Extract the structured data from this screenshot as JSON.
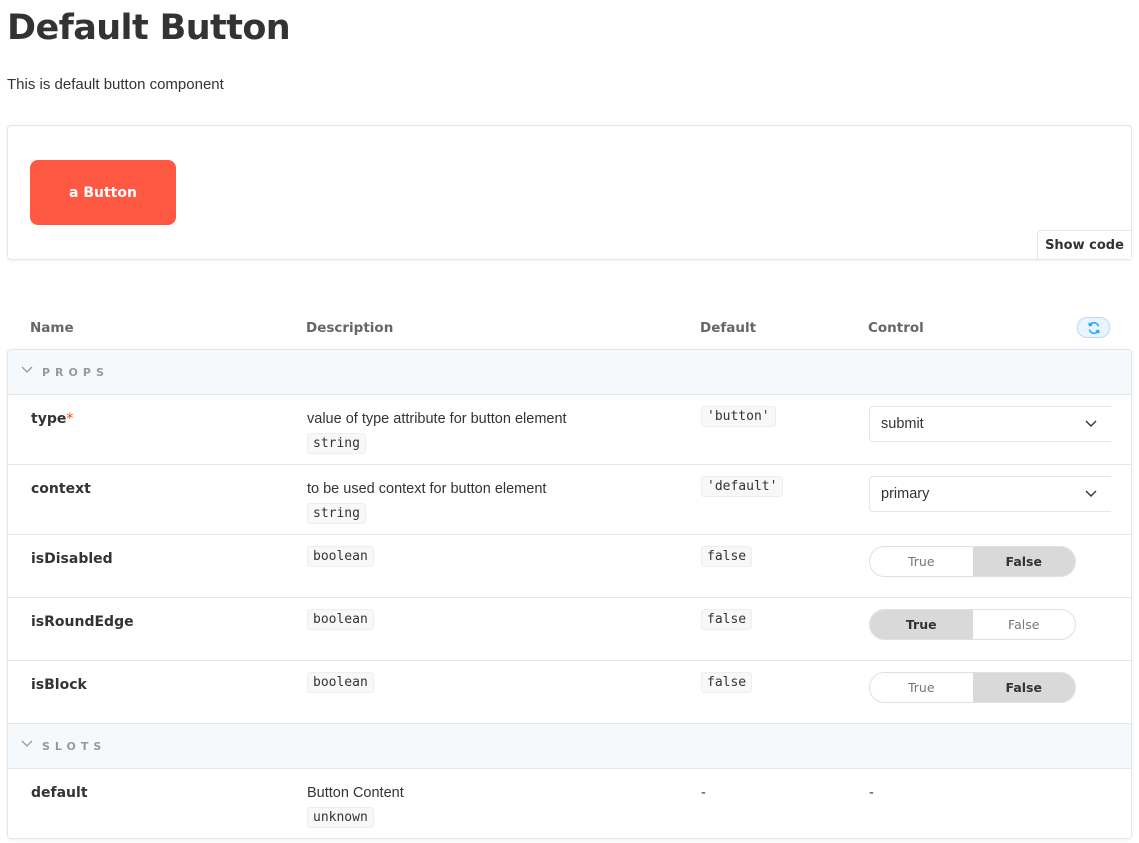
{
  "page": {
    "title": "Default Button",
    "subtitle": "This is default button component"
  },
  "preview": {
    "button_label": "a Button",
    "show_code_label": "Show code"
  },
  "table": {
    "headers": {
      "name": "Name",
      "description": "Description",
      "default": "Default",
      "control": "Control"
    },
    "reset_icon": "refresh-icon",
    "sections": {
      "props_label": "PROPS",
      "slots_label": "SLOTS"
    },
    "props": [
      {
        "name": "type",
        "required_mark": "*",
        "description": "value of type attribute for button element",
        "type": "string",
        "default": "'button'",
        "control_value": "submit"
      },
      {
        "name": "context",
        "description": "to be used context for button element",
        "type": "string",
        "default": "'default'",
        "control_value": "primary"
      },
      {
        "name": "isDisabled",
        "type": "boolean",
        "default": "false",
        "toggle_true": "True",
        "toggle_false": "False",
        "selected": "False"
      },
      {
        "name": "isRoundEdge",
        "type": "boolean",
        "default": "false",
        "toggle_true": "True",
        "toggle_false": "False",
        "selected": "True"
      },
      {
        "name": "isBlock",
        "type": "boolean",
        "default": "false",
        "toggle_true": "True",
        "toggle_false": "False",
        "selected": "False"
      }
    ],
    "slots": [
      {
        "name": "default",
        "description": "Button Content",
        "type": "unknown",
        "default": "-",
        "control": "-"
      }
    ]
  },
  "colors": {
    "button_bg": "#ff5842",
    "required": "#ff4400",
    "section_bg": "#f6f9fc",
    "reset_accent": "#1ea7fd"
  }
}
